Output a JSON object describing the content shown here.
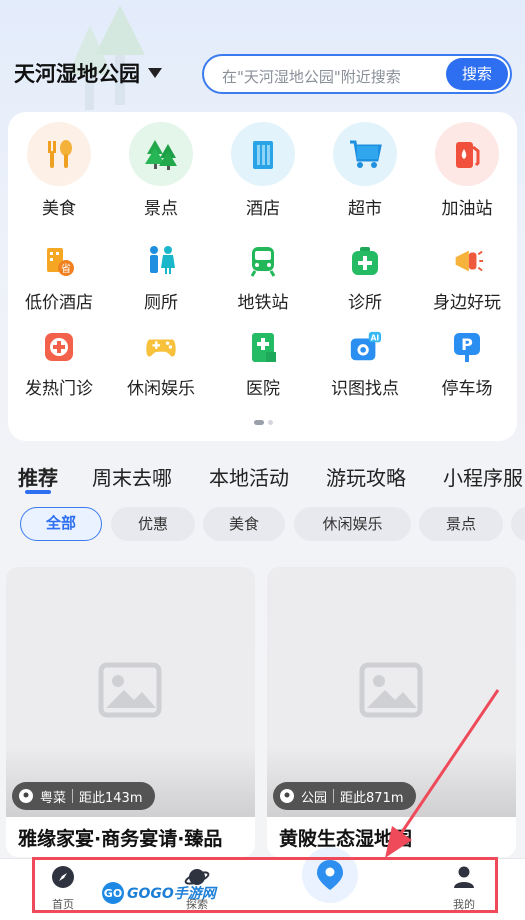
{
  "header": {
    "location": "天河湿地公园",
    "search_placeholder": "在\"天河湿地公园\"附近搜索",
    "search_button": "搜索"
  },
  "categories_big": [
    {
      "label": "美食",
      "icon": "food-icon"
    },
    {
      "label": "景点",
      "icon": "tree-icon"
    },
    {
      "label": "酒店",
      "icon": "hotel-icon"
    },
    {
      "label": "超市",
      "icon": "cart-icon"
    },
    {
      "label": "加油站",
      "icon": "fuel-icon"
    }
  ],
  "categories_row2": [
    {
      "label": "低价酒店",
      "icon": "budget-hotel-icon"
    },
    {
      "label": "厕所",
      "icon": "toilet-icon"
    },
    {
      "label": "地铁站",
      "icon": "metro-icon"
    },
    {
      "label": "诊所",
      "icon": "clinic-icon"
    },
    {
      "label": "身边好玩",
      "icon": "megaphone-icon"
    }
  ],
  "categories_row3": [
    {
      "label": "发热门诊",
      "icon": "fever-clinic-icon"
    },
    {
      "label": "休闲娱乐",
      "icon": "gamepad-icon"
    },
    {
      "label": "医院",
      "icon": "hospital-icon"
    },
    {
      "label": "识图找点",
      "icon": "ai-camera-icon"
    },
    {
      "label": "停车场",
      "icon": "parking-icon"
    }
  ],
  "tabs": [
    "推荐",
    "周末去哪",
    "本地活动",
    "游玩攻略",
    "小程序服"
  ],
  "chips": [
    "全部",
    "优惠",
    "美食",
    "休闲娱乐",
    "景点"
  ],
  "feed": [
    {
      "category": "粤菜",
      "distance": "距此143m",
      "title": "雅缘家宴·商务宴请·臻品"
    },
    {
      "category": "公园",
      "distance": "距此871m",
      "title": "黄陂生态湿地园"
    }
  ],
  "bottom_nav": {
    "home": "首页",
    "explore": "探索",
    "mine": "我的"
  },
  "watermark": {
    "badge": "GO",
    "text": "GOGO手游网"
  },
  "colors": {
    "accent": "#2d6ff0",
    "highlight": "#ee4a5a"
  }
}
